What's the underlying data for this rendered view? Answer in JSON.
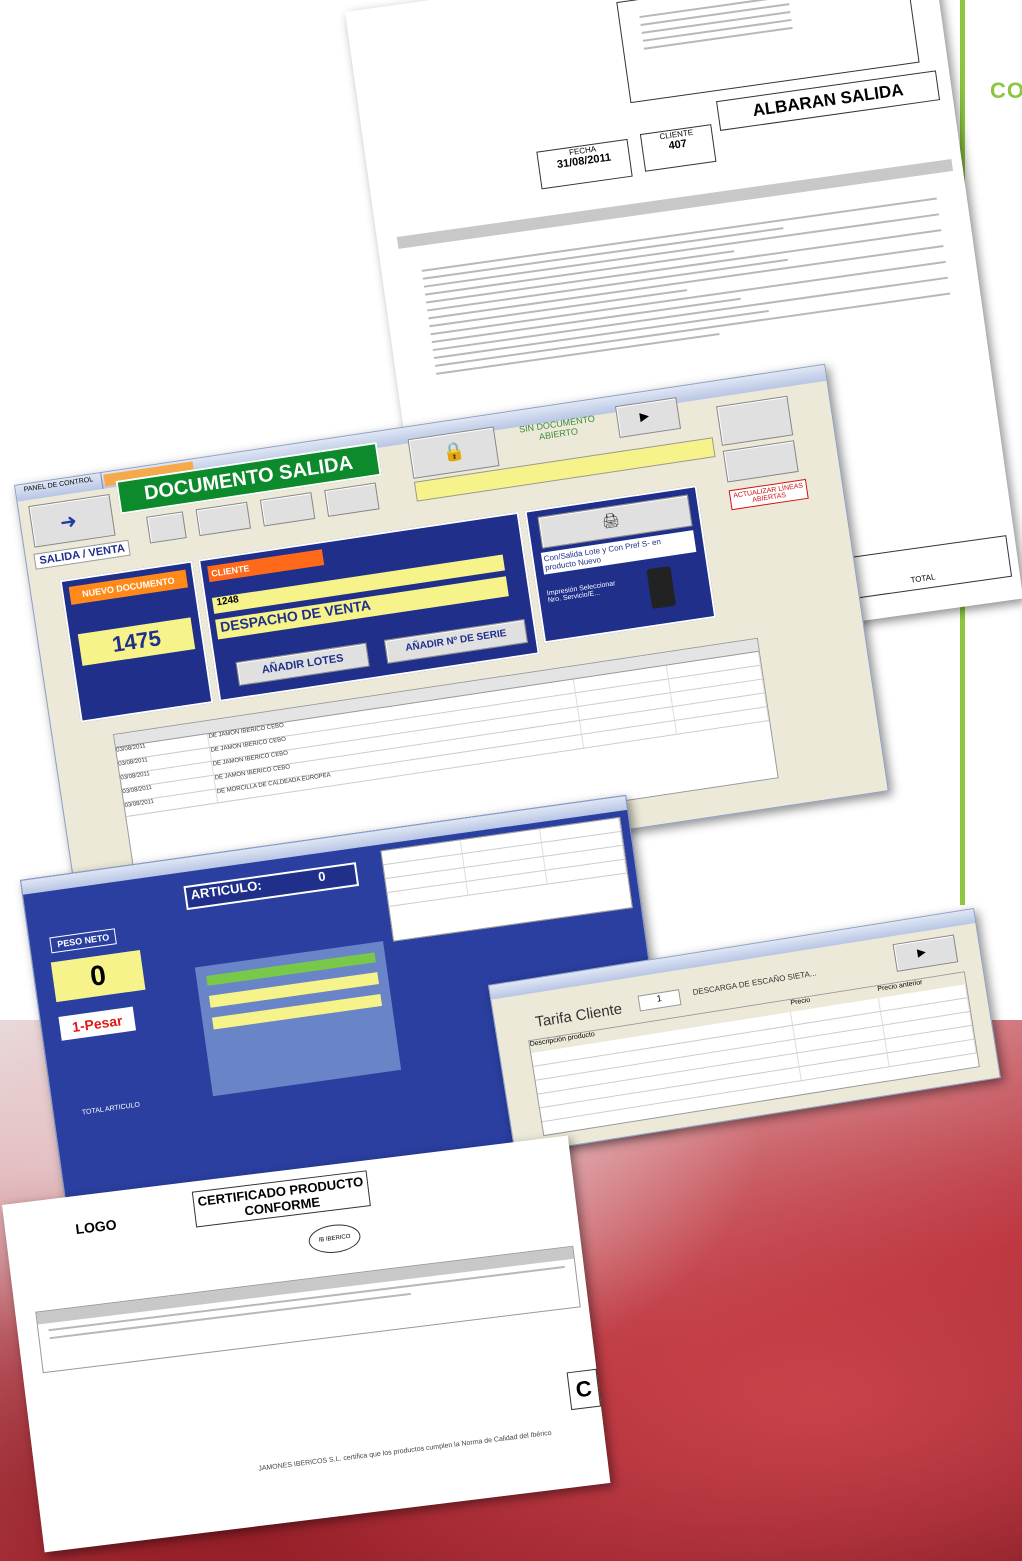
{
  "brand": {
    "partial_heading": "CO",
    "accent": "#8dc63f"
  },
  "albaran": {
    "title": "ALBARAN SALIDA",
    "fecha_label": "FECHA",
    "fecha_value": "31/08/2011",
    "cliente_label": "CLIENTE",
    "cliente_value": "407",
    "total_label": "TOTAL"
  },
  "salida_window": {
    "title": "DOCUMENTO SALIDA",
    "tab_label": "PANEL DE CONTROL",
    "tipo_select": "SALIDA / VENTA",
    "nuevo_doc_label": "NUEVO DOCUMENTO",
    "doc_number": "1475",
    "cliente_label": "CLIENTE",
    "cliente_code": "1248",
    "despacho": "DESPACHO DE VENTA",
    "anadir_lotes": "AÑADIR LOTES",
    "anadir_serie": "AÑADIR Nº DE SERIE",
    "sin_doc": "SIN DOCUMENTO ABIERTO",
    "info_text": "Con/Salida Lote y Con Pref S- en producto Nuevo",
    "impresion_text": "Impresión Seleccionar Nro. Servicio/E...",
    "actualizar": "ACTUALIZAR LÍNEAS ABIERTAS",
    "rows": [
      {
        "fecha": "03/08/2011",
        "desc": "DE JAMON IBERICO CEBO"
      },
      {
        "fecha": "03/08/2011",
        "desc": "DE JAMON IBERICO CEBO"
      },
      {
        "fecha": "03/08/2011",
        "desc": "DE JAMON IBERICO CEBO"
      },
      {
        "fecha": "03/08/2011",
        "desc": "DE JAMON IBERICO CEBO"
      },
      {
        "fecha": "03/08/2011",
        "desc": "DE MORCILLA DE CALDEADA EUROPEA"
      }
    ]
  },
  "pesada_window": {
    "articulo_label": "ARTICULO:",
    "articulo_value": "0",
    "peso_neto_label": "PESO NETO",
    "peso_value": "0",
    "pesar_label": "1-Pesar",
    "total_articulo": "TOTAL ARTICULO"
  },
  "tarifa_window": {
    "title": "Tarifa Cliente",
    "filter_value": "1",
    "filter_label": "DESCARGA DE ESCAÑO SIETA...",
    "col_desc": "Descripción producto",
    "col_precio": "Precio",
    "col_antes": "Precio anterior"
  },
  "certificado": {
    "logo": "LOGO",
    "title": "CERTIFICADO PRODUCTO CONFORME",
    "stamp": "IB IBERICO",
    "footer_text": "JAMONES IBERICOS S.L. certifica que los productos cumplen la Norma de Calidad del Ibérico"
  }
}
